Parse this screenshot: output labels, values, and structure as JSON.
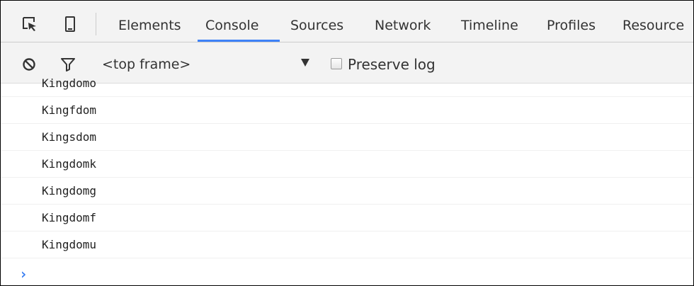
{
  "toolbar": {
    "icons": [
      "inspect-element-icon",
      "device-mode-icon"
    ],
    "tabs": [
      "Elements",
      "Console",
      "Sources",
      "Network",
      "Timeline",
      "Profiles",
      "Resource"
    ],
    "active_tab": "Console",
    "accent_color": "#3e82f7"
  },
  "console_toolbar": {
    "icons": [
      "clear-console-icon",
      "filter-icon"
    ],
    "frame_select": "<top frame>",
    "preserve_log_label": "Preserve log",
    "preserve_log_checked": false
  },
  "console": {
    "messages": [
      "Kingdomo",
      "Kingfdom",
      "Kingsdom",
      "Kingdomk",
      "Kingdomg",
      "Kingdomf",
      "Kingdomu"
    ],
    "prompt_symbol": "›",
    "prompt_color": "#367cf1"
  }
}
